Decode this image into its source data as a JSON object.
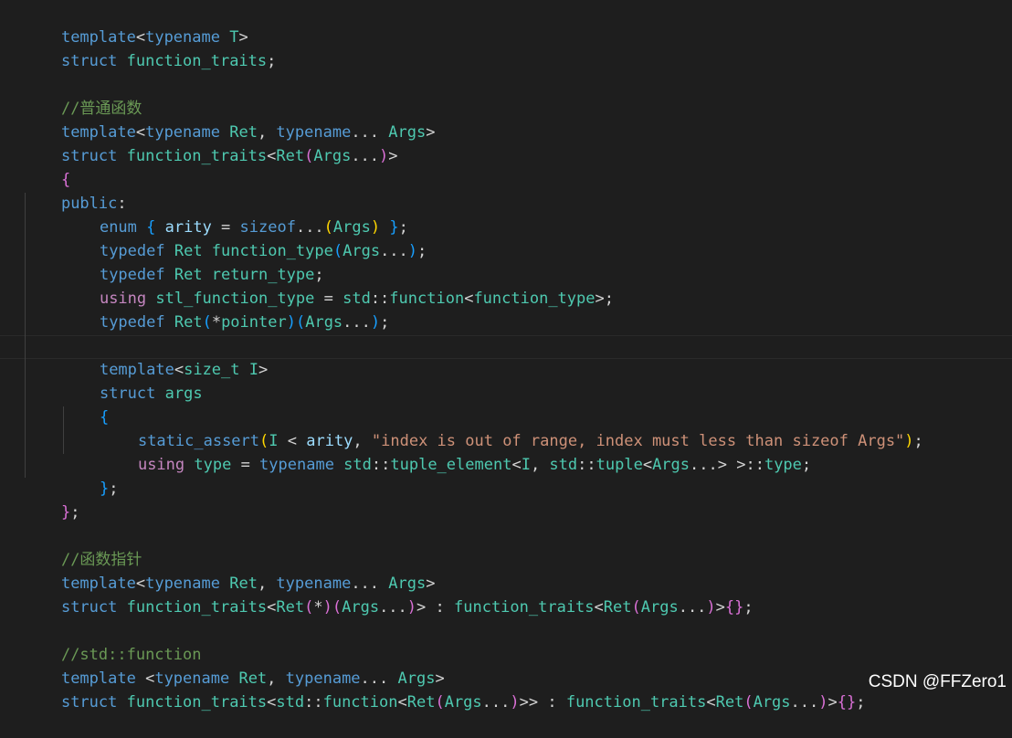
{
  "code": {
    "l0": {
      "a": "template",
      "b": "<",
      "c": "typename",
      "d": " T",
      "e": ">"
    },
    "l1": {
      "a": "struct",
      "b": " function_traits",
      "c": ";"
    },
    "l3": {
      "a": "//普通函数"
    },
    "l4": {
      "a": "template",
      "b": "<",
      "c": "typename",
      "d": " Ret",
      "e": ", ",
      "f": "typename",
      "g": "... ",
      "h": "Args",
      "i": ">"
    },
    "l5": {
      "a": "struct",
      "b": " function_traits",
      "c": "<",
      "d": "Ret",
      "e": "(",
      "f": "Args",
      "g": "...",
      "h": ")",
      "i": ">"
    },
    "l6": {
      "a": "{"
    },
    "l7": {
      "a": "public",
      "b": ":"
    },
    "l8": {
      "a": "enum",
      "b": " {",
      "c": " arity",
      "d": " = ",
      "e": "sizeof",
      "f": "...",
      "g": "(",
      "h": "Args",
      "i": ")",
      "j": " }",
      "k": ";"
    },
    "l9": {
      "a": "typedef",
      "b": " Ret",
      "c": " function_type",
      "d": "(",
      "e": "Args",
      "f": "...",
      "g": ")",
      "h": ";"
    },
    "l10": {
      "a": "typedef",
      "b": " Ret",
      "c": " return_type",
      "d": ";"
    },
    "l11": {
      "a": "using",
      "b": " stl_function_type",
      "c": " = ",
      "d": "std",
      "e": "::",
      "f": "function",
      "g": "<",
      "h": "function_type",
      "i": ">",
      "j": ";"
    },
    "l12": {
      "a": "typedef",
      "b": " Ret",
      "c": "(",
      "d": "*",
      "e": "pointer",
      "f": ")",
      "g": "(",
      "h": "Args",
      "i": "...",
      "j": ")",
      "k": ";"
    },
    "l14": {
      "a": "template",
      "b": "<",
      "c": "size_t",
      "d": " I",
      "e": ">"
    },
    "l15": {
      "a": "struct",
      "b": " args"
    },
    "l16": {
      "a": "{"
    },
    "l17": {
      "a": "static_assert",
      "b": "(",
      "c": "I",
      "d": " < ",
      "e": "arity",
      "f": ", ",
      "g": "\"index is out of range, index must less than sizeof Args\"",
      "h": ")",
      "i": ";"
    },
    "l18": {
      "a": "using",
      "b": " type",
      "c": " = ",
      "d": "typename",
      "e": " std",
      "f": "::",
      "g": "tuple_element",
      "h": "<",
      "i": "I",
      "j": ", ",
      "k": "std",
      "l": "::",
      "m": "tuple",
      "n": "<",
      "o": "Args",
      "p": "...",
      "q": ">",
      "r": " >",
      "s": "::",
      "t": "type",
      "u": ";"
    },
    "l19": {
      "a": "}",
      "b": ";"
    },
    "l20": {
      "a": "}",
      "b": ";"
    },
    "l22": {
      "a": "//函数指针"
    },
    "l23": {
      "a": "template",
      "b": "<",
      "c": "typename",
      "d": " Ret",
      "e": ", ",
      "f": "typename",
      "g": "... ",
      "h": "Args",
      "i": ">"
    },
    "l24": {
      "a": "struct",
      "b": " function_traits",
      "c": "<",
      "d": "Ret",
      "e": "(",
      "f": "*",
      "g": ")",
      "h": "(",
      "i": "Args",
      "j": "...",
      "k": ")",
      "l": ">",
      "m": " : ",
      "n": "function_traits",
      "o": "<",
      "p": "Ret",
      "q": "(",
      "r": "Args",
      "s": "...",
      "t": ")",
      "u": ">",
      "v": "{}",
      "w": ";"
    },
    "l26": {
      "a": "//std::function"
    },
    "l27": {
      "a": "template",
      "b": " <",
      "c": "typename",
      "d": " Ret",
      "e": ", ",
      "f": "typename",
      "g": "... ",
      "h": "Args",
      "i": ">"
    },
    "l28": {
      "a": "struct",
      "b": " function_traits",
      "c": "<",
      "d": "std",
      "e": "::",
      "f": "function",
      "g": "<",
      "h": "Ret",
      "i": "(",
      "j": "Args",
      "k": "...",
      "l": ")",
      "m": ">>",
      "n": " : ",
      "o": "function_traits",
      "p": "<",
      "q": "Ret",
      "r": "(",
      "s": "Args",
      "t": "...",
      "u": ")",
      "v": ">",
      "w": "{}",
      "x": ";"
    }
  },
  "watermark": "CSDN @FFZero1",
  "colors": {
    "background": "#1e1e1e",
    "keyword": "#569cd6",
    "control": "#c586c0",
    "type": "#4ec9b0",
    "function": "#dcdcaa",
    "variable": "#9cdcfe",
    "string": "#ce9178",
    "comment": "#6a9955"
  }
}
